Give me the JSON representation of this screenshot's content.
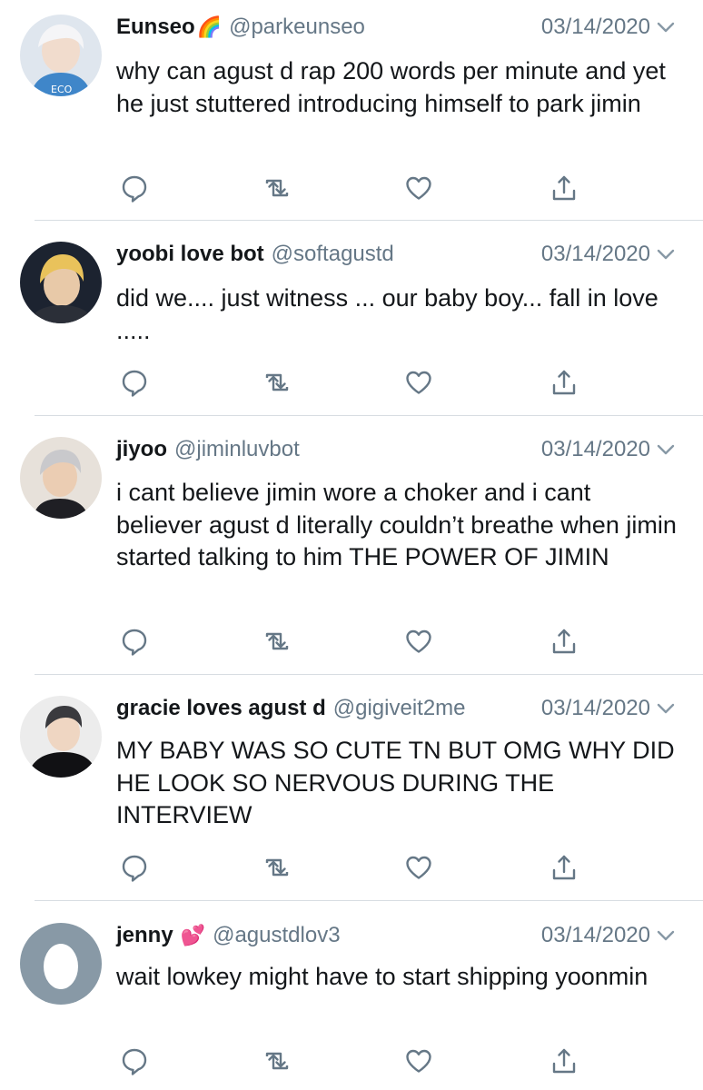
{
  "colors": {
    "name": "#14171a",
    "secondary": "#657786",
    "divider": "#d8dde2",
    "icon": "#657786"
  },
  "tweets": [
    {
      "name": "Eunseo",
      "emoji": "🌈",
      "handle": "@parkeunseo",
      "date": "03/14/2020",
      "text": "why can agust d rap 200 words per minute and yet he just stuttered introducing himself to park jimin",
      "avatar": "photo-avatar-icon"
    },
    {
      "name": "yoobi love bot",
      "emoji": "",
      "handle": "@softagustd",
      "date": "03/14/2020",
      "text": "did we.... just witness ... our baby boy... fall in love .....",
      "avatar": "photo-avatar-icon"
    },
    {
      "name": "jiyoo",
      "emoji": "",
      "handle": "@jiminluvbot",
      "date": "03/14/2020",
      "text": "i cant believe jimin wore a choker and i cant believer agust d literally couldn’t breathe when jimin started talking to him THE POWER OF JIMIN",
      "avatar": "photo-avatar-icon"
    },
    {
      "name": "gracie loves agust d",
      "emoji": "",
      "handle": "@gigiveit2me",
      "date": "03/14/2020",
      "text": "MY BABY WAS SO CUTE TN BUT OMG WHY DID HE LOOK SO NERVOUS DURING THE INTERVIEW",
      "avatar": "photo-avatar-icon"
    },
    {
      "name": "jenny",
      "emoji": "💕",
      "handle": "@agustdlov3",
      "date": "03/14/2020",
      "text": "wait lowkey might have to start shipping yoonmin",
      "avatar": "default-egg-avatar-icon"
    }
  ]
}
